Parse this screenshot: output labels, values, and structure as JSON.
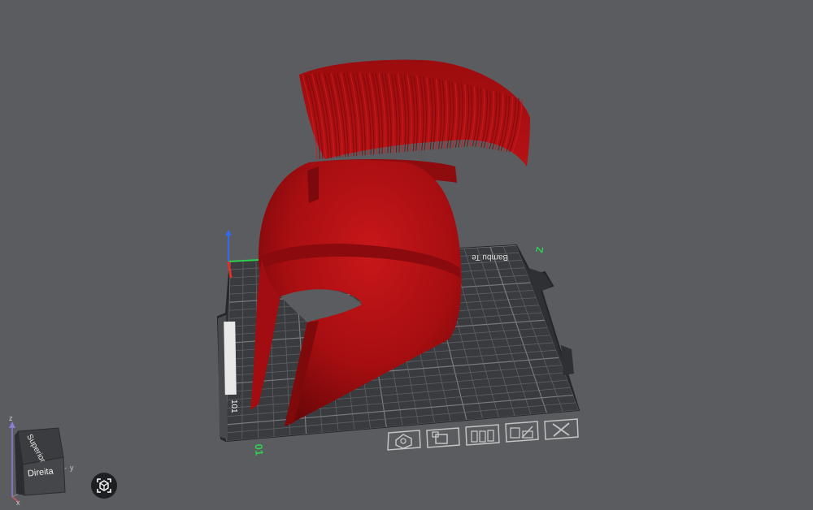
{
  "plate": {
    "brand_label": "Bambu Te",
    "corner_origin_label": "01",
    "corner_far_label": "Z",
    "side_label": "101"
  },
  "toolbar": {
    "items": [
      "orient-icon",
      "arrange-icon",
      "layout-icon",
      "edit-icon",
      "close-icon"
    ]
  },
  "view_cube": {
    "face_top": "Superior",
    "face_right": "Direita",
    "axis_z": "z",
    "axis_y": "y",
    "axis_x": "x"
  },
  "recenter": {
    "icon": "view-center-icon"
  },
  "colors": {
    "background": "#5b5c60",
    "plate": "#3a3b3e",
    "grid": "#6c6d72",
    "model": "#b40f12",
    "model_dark": "#7e0a0c",
    "axis_x": "#e0302a",
    "axis_y": "#2fcf52",
    "axis_z": "#2f6af0",
    "plate_label_green": "#2fcf52"
  }
}
